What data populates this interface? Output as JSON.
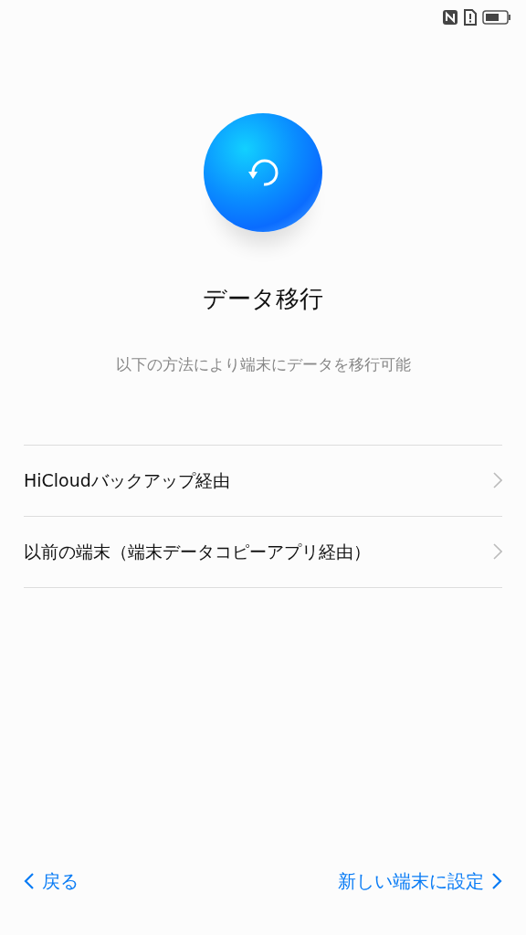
{
  "title": "データ移行",
  "subtitle": "以下の方法により端末にデータを移行可能",
  "options": [
    {
      "label": "HiCloudバックアップ経由"
    },
    {
      "label": "以前の端末（端末データコピーアプリ経由）"
    }
  ],
  "footer": {
    "back": "戻る",
    "next": "新しい端末に設定"
  }
}
